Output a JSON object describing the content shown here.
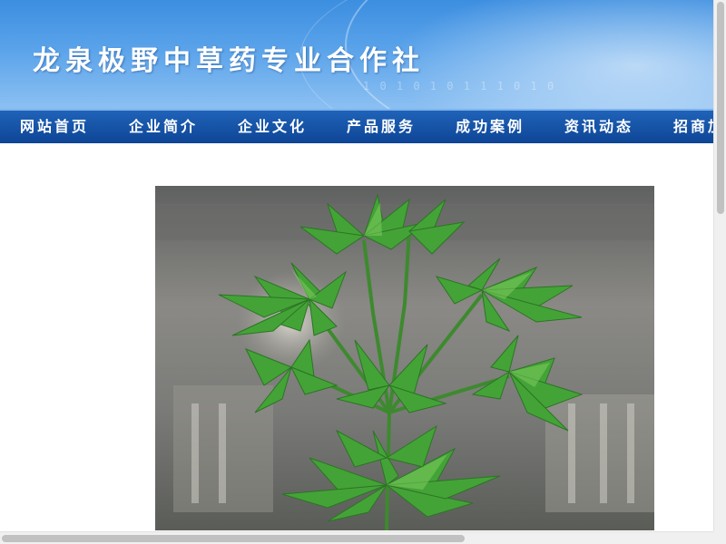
{
  "header": {
    "title": "龙泉极野中草药专业合作社",
    "binary_decoration": "1 0 1 0 1 0 1 1 1 0 1 0"
  },
  "nav": {
    "items": [
      {
        "label": "网站首页"
      },
      {
        "label": "企业简介"
      },
      {
        "label": "企业文化"
      },
      {
        "label": "产品服务"
      },
      {
        "label": "成功案例"
      },
      {
        "label": "资讯动态"
      },
      {
        "label": "招商加盟"
      }
    ]
  },
  "colors": {
    "banner_top": "#3c8ee0",
    "banner_bottom": "#8cc0f2",
    "nav_top": "#1f63b8",
    "nav_bottom": "#0e4596",
    "plant_green": "#3f9a32"
  },
  "main": {
    "photo_icon": "herb-plant-photo"
  }
}
